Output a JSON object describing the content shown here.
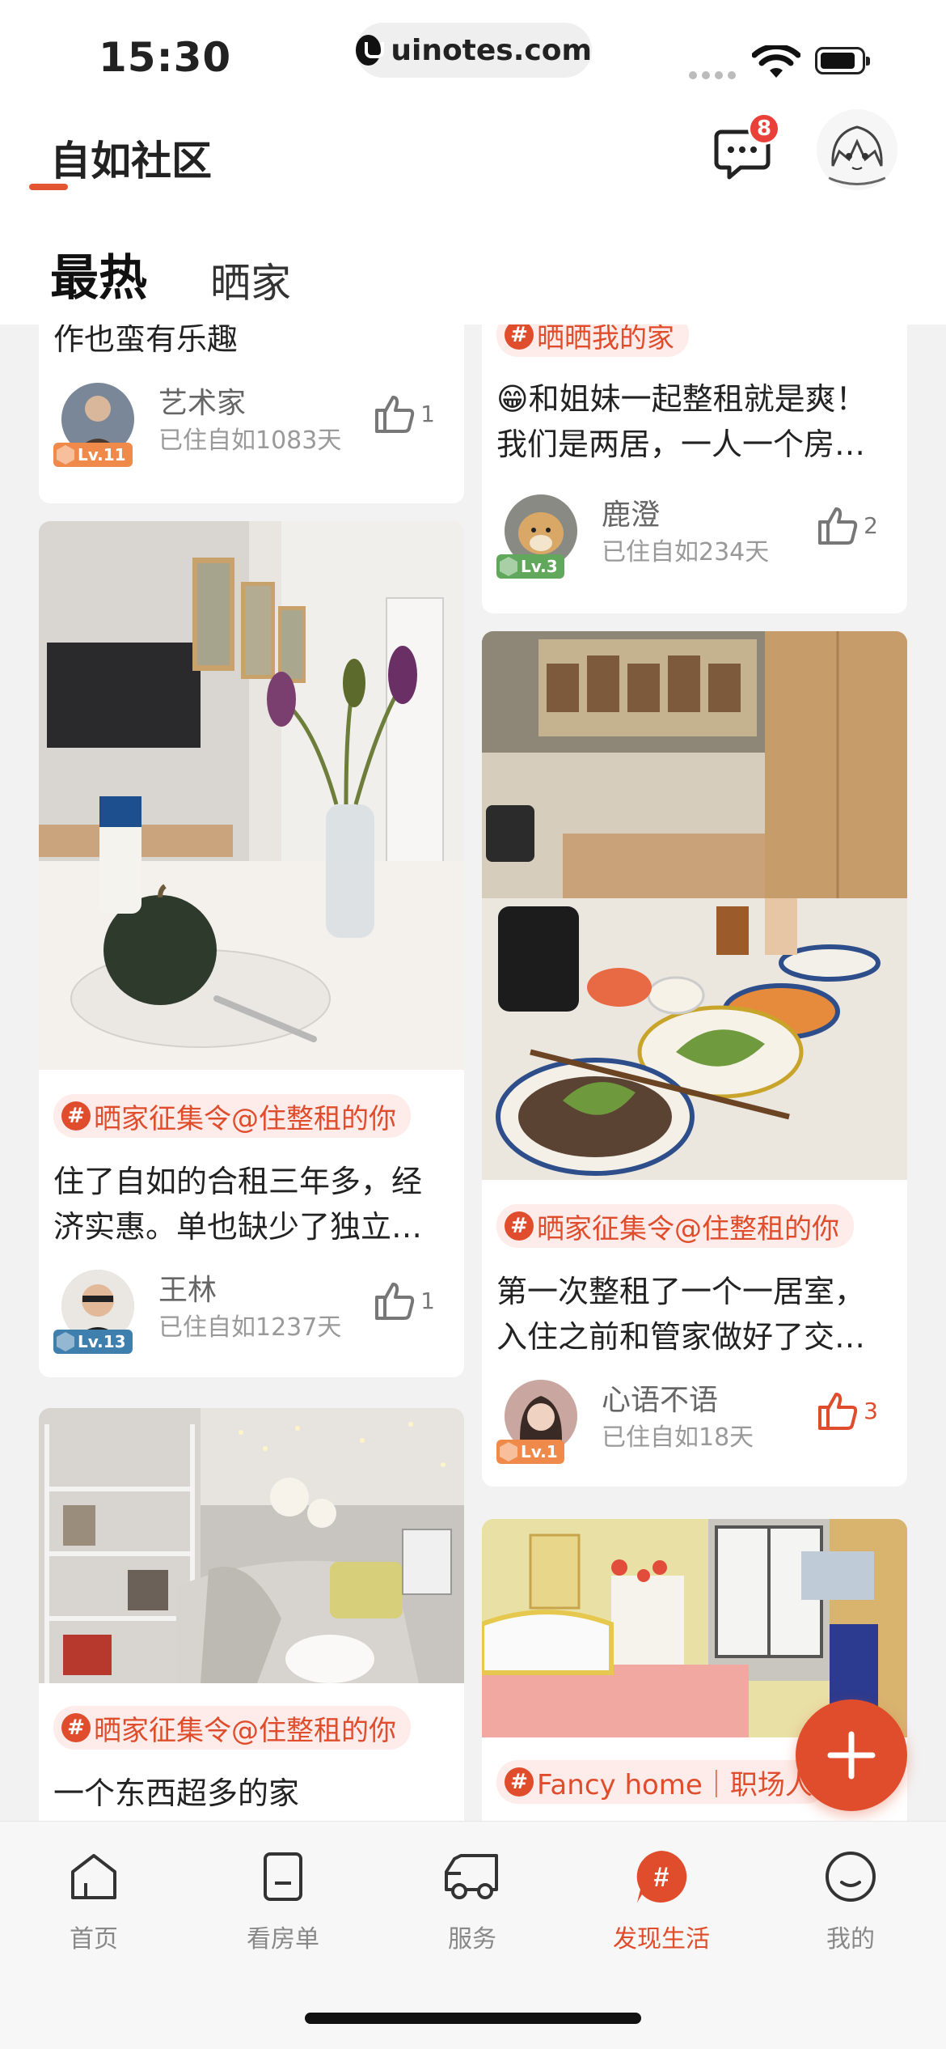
{
  "status_bar": {
    "time": "15:30",
    "url": "uinotes.com"
  },
  "header": {
    "title": "自如社区",
    "message_badge": "8",
    "tabs": [
      {
        "label": "最热",
        "active": true
      },
      {
        "label": "晒家",
        "active": false
      }
    ]
  },
  "feed": {
    "left_column": [
      {
        "text": "作也蛮有乐趣",
        "author": "艺术家",
        "days": "已住自如1083天",
        "level": "Lv.11",
        "likes": "1"
      },
      {
        "hashtag": "晒家征集令@住整租的你",
        "text_line1": "住了自如的合租三年多，经",
        "text_line2": "济实惠。单也缺少了独立…",
        "author": "王林",
        "days": "已住自如1237天",
        "level": "Lv.13",
        "likes": "1"
      },
      {
        "hashtag": "晒家征集令@住整租的你",
        "text": "一个东西超多的家"
      }
    ],
    "right_column": [
      {
        "hashtag": "晒晒我的家",
        "text_line1": "😁和姐妹一起整租就是爽！",
        "text_line2": "我们是两居，一人一个房…",
        "author": "鹿澄",
        "days": "已住自如234天",
        "level": "Lv.3",
        "likes": "2"
      },
      {
        "hashtag": "晒家征集令@住整租的你",
        "text_line1": "第一次整租了一个一居室，",
        "text_line2": "入住之前和管家做好了交…",
        "author": "心语不语",
        "days": "已住自如18天",
        "level": "Lv.1",
        "likes": "3"
      },
      {
        "hashtag": "Fancy home｜职场人"
      }
    ]
  },
  "tab_bar": {
    "items": [
      {
        "label": "首页",
        "icon": "home-icon"
      },
      {
        "label": "看房单",
        "icon": "list-icon"
      },
      {
        "label": "服务",
        "icon": "truck-icon"
      },
      {
        "label": "发现生活",
        "icon": "hashtag-icon",
        "active": true
      },
      {
        "label": "我的",
        "icon": "smile-icon"
      }
    ]
  },
  "colors": {
    "accent": "#e04d2c",
    "badge": "#e9403a",
    "background": "#f2f2f2"
  }
}
